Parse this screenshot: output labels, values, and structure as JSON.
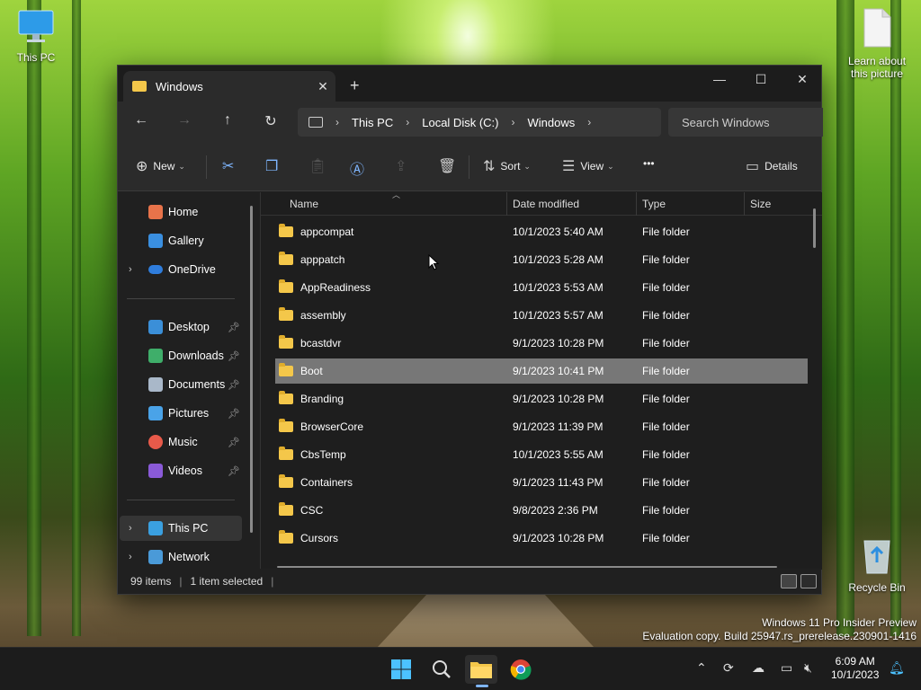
{
  "desktop": {
    "icons": [
      {
        "label": "This PC"
      },
      {
        "label": "Learn about this picture"
      },
      {
        "label": "Recycle Bin"
      }
    ],
    "watermark": {
      "line1": "Windows 11 Pro Insider Preview",
      "line2": "Evaluation copy. Build 25947.rs_prerelease.230901-1416"
    }
  },
  "window": {
    "tab_title": "Windows",
    "close_tab": "✕",
    "new_tab": "+",
    "controls": {
      "minimize": "—",
      "maximize": "☐",
      "close": "✕"
    },
    "nav": {
      "back": "←",
      "forward": "→",
      "up": "↑",
      "refresh": "↻"
    },
    "breadcrumb": [
      "This PC",
      "Local Disk (C:)",
      "Windows"
    ],
    "breadcrumb_sep": "›",
    "search_placeholder": "Search Windows",
    "toolbar": {
      "new": "New",
      "sort": "Sort",
      "view": "View",
      "more": "•••",
      "details": "Details"
    },
    "sidebar": {
      "top": [
        {
          "label": "Home",
          "icon": "home-icon",
          "color": "#e8734a"
        },
        {
          "label": "Gallery",
          "icon": "gallery-icon",
          "color": "#3a8fe0"
        },
        {
          "label": "OneDrive",
          "icon": "onedrive-icon",
          "color": "#2f7ddc"
        }
      ],
      "pinned": [
        {
          "label": "Desktop",
          "icon": "desktop-icon",
          "color": "#3b8fd8"
        },
        {
          "label": "Downloads",
          "icon": "downloads-icon",
          "color": "#3fae6a"
        },
        {
          "label": "Documents",
          "icon": "documents-icon",
          "color": "#a9b8c9"
        },
        {
          "label": "Pictures",
          "icon": "pictures-icon",
          "color": "#4aa3e8"
        },
        {
          "label": "Music",
          "icon": "music-icon",
          "color": "#e85a4a"
        },
        {
          "label": "Videos",
          "icon": "videos-icon",
          "color": "#8a5ad8"
        }
      ],
      "bottom": [
        {
          "label": "This PC",
          "icon": "this-pc-icon",
          "color": "#3aa0e0"
        },
        {
          "label": "Network",
          "icon": "network-icon",
          "color": "#4a9ad8"
        }
      ]
    },
    "columns": {
      "name": "Name",
      "date": "Date modified",
      "type": "Type",
      "size": "Size"
    },
    "files": [
      {
        "name": "appcompat",
        "date": "10/1/2023 5:40 AM",
        "type": "File folder"
      },
      {
        "name": "apppatch",
        "date": "10/1/2023 5:28 AM",
        "type": "File folder"
      },
      {
        "name": "AppReadiness",
        "date": "10/1/2023 5:53 AM",
        "type": "File folder"
      },
      {
        "name": "assembly",
        "date": "10/1/2023 5:57 AM",
        "type": "File folder"
      },
      {
        "name": "bcastdvr",
        "date": "9/1/2023 10:28 PM",
        "type": "File folder"
      },
      {
        "name": "Boot",
        "date": "9/1/2023 10:41 PM",
        "type": "File folder",
        "selected": true
      },
      {
        "name": "Branding",
        "date": "9/1/2023 10:28 PM",
        "type": "File folder"
      },
      {
        "name": "BrowserCore",
        "date": "9/1/2023 11:39 PM",
        "type": "File folder"
      },
      {
        "name": "CbsTemp",
        "date": "10/1/2023 5:55 AM",
        "type": "File folder"
      },
      {
        "name": "Containers",
        "date": "9/1/2023 11:43 PM",
        "type": "File folder"
      },
      {
        "name": "CSC",
        "date": "9/8/2023 2:36 PM",
        "type": "File folder"
      },
      {
        "name": "Cursors",
        "date": "9/1/2023 10:28 PM",
        "type": "File folder"
      }
    ],
    "status": {
      "count": "99 items",
      "selection": "1 item selected"
    }
  },
  "taskbar": {
    "clock_time": "6:09 AM",
    "clock_date": "10/1/2023",
    "accent": "#7fb6ff"
  }
}
